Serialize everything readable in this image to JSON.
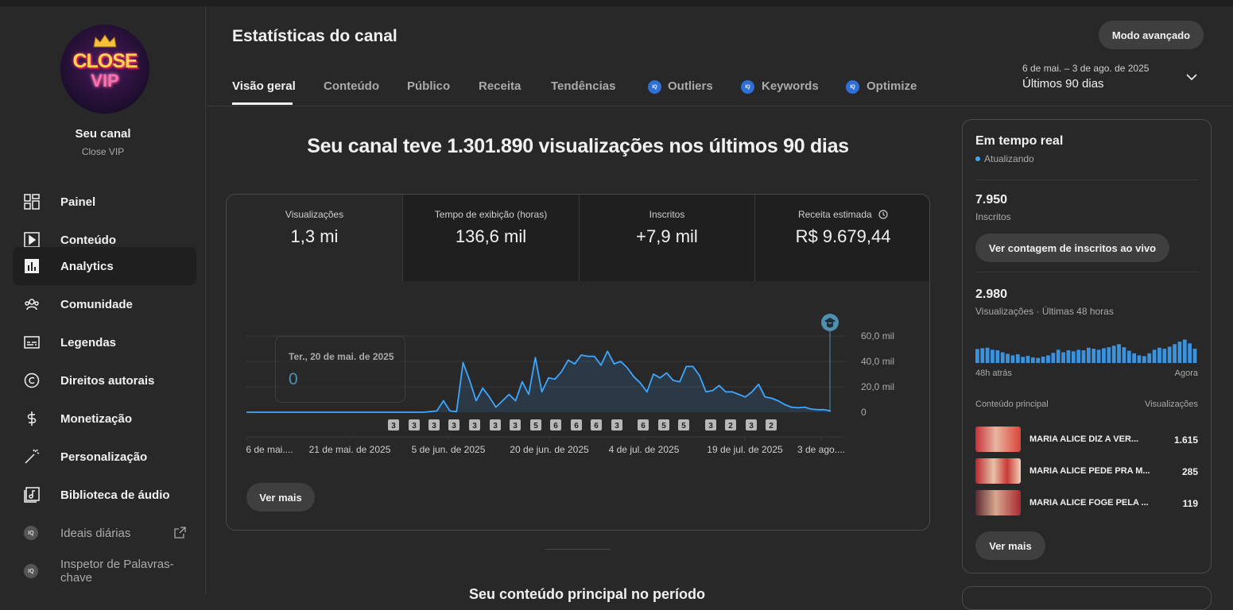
{
  "channel": {
    "title": "Seu canal",
    "name": "Close VIP",
    "logo_line1": "CLOSE",
    "logo_line2": "VIP"
  },
  "sidebar": {
    "items": [
      {
        "label": "Painel",
        "icon": "dashboard-icon"
      },
      {
        "label": "Conteúdo",
        "icon": "video-icon"
      },
      {
        "label": "Analytics",
        "icon": "analytics-icon",
        "active": true
      },
      {
        "label": "Comunidade",
        "icon": "community-icon"
      },
      {
        "label": "Legendas",
        "icon": "subtitles-icon"
      },
      {
        "label": "Direitos autorais",
        "icon": "copyright-icon"
      },
      {
        "label": "Monetização",
        "icon": "dollar-icon"
      },
      {
        "label": "Personalização",
        "icon": "magic-wand-icon"
      },
      {
        "label": "Biblioteca de áudio",
        "icon": "audio-library-icon"
      },
      {
        "label": "Ideais diárias",
        "icon": "vidiq-icon"
      },
      {
        "label": "Inspetor de Palavras-chave",
        "icon": "vidiq-icon"
      }
    ],
    "vidiq_badge": "IQ"
  },
  "header": {
    "title": "Estatísticas do canal",
    "advanced_button": "Modo avançado",
    "date_range": "6 de mai. – 3 de ago. de 2025",
    "date_label": "Últimos 90 dias",
    "tabs": [
      "Visão geral",
      "Conteúdo",
      "Público",
      "Receita",
      "Tendências",
      "Outliers",
      "Keywords",
      "Optimize"
    ]
  },
  "headline": "Seu canal teve 1.301.890 visualizações nos últimos 90 dias",
  "metrics": [
    {
      "label": "Visualizações",
      "value": "1,3 mi"
    },
    {
      "label": "Tempo de exibição (horas)",
      "value": "136,6 mil"
    },
    {
      "label": "Inscritos",
      "value": "+7,9 mil"
    },
    {
      "label": "Receita estimada",
      "value": "R$ 9.679,44"
    }
  ],
  "tooltip": {
    "date": "Ter., 20 de mai. de 2025",
    "value": "0"
  },
  "chart_data": {
    "type": "area",
    "ylim": [
      0,
      60000
    ],
    "yticks": [
      "60,0 mil",
      "40,0 mil",
      "20,0 mil",
      "0"
    ],
    "xtick_labels": [
      "6 de mai....",
      "21 de mai. de 2025",
      "5 de jun. de 2025",
      "20 de jun. de 2025",
      "4 de jul. de 2025",
      "19 de jul. de 2025",
      "3 de ago...."
    ],
    "series": [
      {
        "color": "#3ea6ff",
        "values": [
          0,
          0,
          0,
          0,
          0,
          0,
          0,
          0,
          0,
          0,
          0,
          0,
          0,
          0,
          0,
          0,
          0,
          0,
          0,
          0,
          0,
          0,
          0,
          0,
          0,
          0,
          0,
          0,
          500,
          1000,
          9000,
          1000,
          500,
          39000,
          25000,
          9000,
          19000,
          12000,
          4000,
          9000,
          14000,
          9000,
          24000,
          14000,
          43000,
          16000,
          27000,
          26000,
          32000,
          41000,
          38000,
          45000,
          44000,
          44000,
          37000,
          48000,
          38000,
          40000,
          35000,
          28000,
          23000,
          16000,
          30000,
          27000,
          31000,
          25000,
          24000,
          36000,
          36000,
          29000,
          16000,
          17000,
          21000,
          16000,
          16000,
          14000,
          12000,
          16000,
          22000,
          12000,
          11000,
          9000,
          6000,
          4000,
          3500,
          4000,
          2500,
          2000,
          2000,
          1000
        ]
      }
    ],
    "annotations": [
      "3",
      "3",
      "3",
      "3",
      "3",
      "3",
      "3",
      "5",
      "6",
      "6",
      "6",
      "3",
      "6",
      "5",
      "5",
      "3",
      "2",
      "3",
      "2"
    ]
  },
  "main_more_button": "Ver mais",
  "bottom_section_title": "Seu conteúdo principal no período",
  "realtime": {
    "title": "Em tempo real",
    "status": "Atualizando",
    "subscribers": "7.950",
    "subscribers_label": "Inscritos",
    "live_button": "Ver contagem de inscritos ao vivo",
    "views": "2.980",
    "views_label": "Visualizações · Últimas 48 horas",
    "axis_left": "48h atrás",
    "axis_right": "Agora",
    "bars": [
      0.55,
      0.58,
      0.6,
      0.52,
      0.5,
      0.42,
      0.36,
      0.3,
      0.34,
      0.24,
      0.28,
      0.22,
      0.2,
      0.25,
      0.3,
      0.4,
      0.52,
      0.42,
      0.5,
      0.46,
      0.52,
      0.5,
      0.6,
      0.56,
      0.52,
      0.58,
      0.62,
      0.68,
      0.74,
      0.62,
      0.48,
      0.38,
      0.3,
      0.27,
      0.38,
      0.52,
      0.6,
      0.56,
      0.64,
      0.74,
      0.84,
      0.92,
      0.77,
      0.56
    ],
    "content_header_left": "Conteúdo principal",
    "content_header_right": "Visualizações",
    "videos": [
      {
        "title": "MARIA ALICE DIZ A VER...",
        "views": "1.615"
      },
      {
        "title": "MARIA ALICE PEDE PRA M...",
        "views": "285"
      },
      {
        "title": "MARIA ALICE FOGE PELA ...",
        "views": "119"
      }
    ],
    "more_button": "Ver mais"
  }
}
